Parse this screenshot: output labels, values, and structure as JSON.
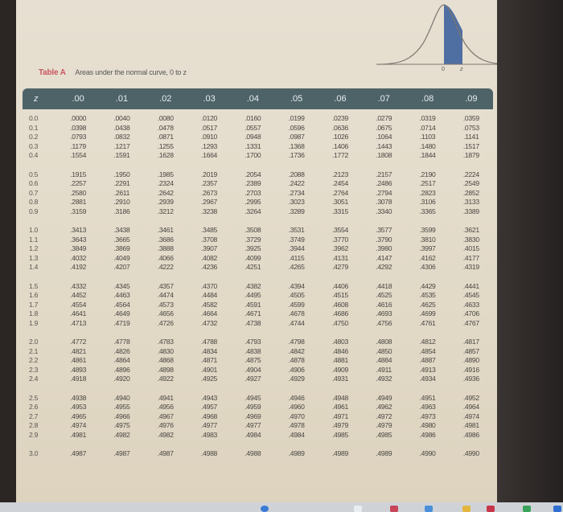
{
  "document": {
    "table_label": "Table A",
    "table_caption": "Areas under the normal curve, 0 to z",
    "figure": {
      "label_zero": "0",
      "label_z": "z",
      "shade_color": "#4f6fa3"
    },
    "columns": [
      "z",
      ".00",
      ".01",
      ".02",
      ".03",
      ".04",
      ".05",
      ".06",
      ".07",
      ".08",
      ".09"
    ],
    "groups": [
      [
        {
          "z": "0.0",
          "v": [
            ".0000",
            ".0040",
            ".0080",
            ".0120",
            ".0160",
            ".0199",
            ".0239",
            ".0279",
            ".0319",
            ".0359"
          ]
        },
        {
          "z": "0.1",
          "v": [
            ".0398",
            ".0438",
            ".0478",
            ".0517",
            ".0557",
            ".0596",
            ".0636",
            ".0675",
            ".0714",
            ".0753"
          ]
        },
        {
          "z": "0.2",
          "v": [
            ".0793",
            ".0832",
            ".0871",
            ".0910",
            ".0948",
            ".0987",
            ".1026",
            ".1064",
            ".1103",
            ".1141"
          ]
        },
        {
          "z": "0.3",
          "v": [
            ".1179",
            ".1217",
            ".1255",
            ".1293",
            ".1331",
            ".1368",
            ".1406",
            ".1443",
            ".1480",
            ".1517"
          ]
        },
        {
          "z": "0.4",
          "v": [
            ".1554",
            ".1591",
            ".1628",
            ".1664",
            ".1700",
            ".1736",
            ".1772",
            ".1808",
            ".1844",
            ".1879"
          ]
        }
      ],
      [
        {
          "z": "0.5",
          "v": [
            ".1915",
            ".1950",
            ".1985",
            ".2019",
            ".2054",
            ".2088",
            ".2123",
            ".2157",
            ".2190",
            ".2224"
          ]
        },
        {
          "z": "0.6",
          "v": [
            ".2257",
            ".2291",
            ".2324",
            ".2357",
            ".2389",
            ".2422",
            ".2454",
            ".2486",
            ".2517",
            ".2549"
          ]
        },
        {
          "z": "0.7",
          "v": [
            ".2580",
            ".2611",
            ".2642",
            ".2673",
            ".2703",
            ".2734",
            ".2764",
            ".2794",
            ".2823",
            ".2852"
          ]
        },
        {
          "z": "0.8",
          "v": [
            ".2881",
            ".2910",
            ".2939",
            ".2967",
            ".2995",
            ".3023",
            ".3051",
            ".3078",
            ".3106",
            ".3133"
          ]
        },
        {
          "z": "0.9",
          "v": [
            ".3159",
            ".3186",
            ".3212",
            ".3238",
            ".3264",
            ".3289",
            ".3315",
            ".3340",
            ".3365",
            ".3389"
          ]
        }
      ],
      [
        {
          "z": "1.0",
          "v": [
            ".3413",
            ".3438",
            ".3461",
            ".3485",
            ".3508",
            ".3531",
            ".3554",
            ".3577",
            ".3599",
            ".3621"
          ]
        },
        {
          "z": "1.1",
          "v": [
            ".3643",
            ".3665",
            ".3686",
            ".3708",
            ".3729",
            ".3749",
            ".3770",
            ".3790",
            ".3810",
            ".3830"
          ]
        },
        {
          "z": "1.2",
          "v": [
            ".3849",
            ".3869",
            ".3888",
            ".3907",
            ".3925",
            ".3944",
            ".3962",
            ".3980",
            ".3997",
            ".4015"
          ]
        },
        {
          "z": "1.3",
          "v": [
            ".4032",
            ".4049",
            ".4066",
            ".4082",
            ".4099",
            ".4115",
            ".4131",
            ".4147",
            ".4162",
            ".4177"
          ]
        },
        {
          "z": "1.4",
          "v": [
            ".4192",
            ".4207",
            ".4222",
            ".4236",
            ".4251",
            ".4265",
            ".4279",
            ".4292",
            ".4306",
            ".4319"
          ]
        }
      ],
      [
        {
          "z": "1.5",
          "v": [
            ".4332",
            ".4345",
            ".4357",
            ".4370",
            ".4382",
            ".4394",
            ".4406",
            ".4418",
            ".4429",
            ".4441"
          ]
        },
        {
          "z": "1.6",
          "v": [
            ".4452",
            ".4463",
            ".4474",
            ".4484",
            ".4495",
            ".4505",
            ".4515",
            ".4525",
            ".4535",
            ".4545"
          ]
        },
        {
          "z": "1.7",
          "v": [
            ".4554",
            ".4564",
            ".4573",
            ".4582",
            ".4591",
            ".4599",
            ".4608",
            ".4616",
            ".4625",
            ".4633"
          ]
        },
        {
          "z": "1.8",
          "v": [
            ".4641",
            ".4649",
            ".4656",
            ".4664",
            ".4671",
            ".4678",
            ".4686",
            ".4693",
            ".4699",
            ".4706"
          ]
        },
        {
          "z": "1.9",
          "v": [
            ".4713",
            ".4719",
            ".4726",
            ".4732",
            ".4738",
            ".4744",
            ".4750",
            ".4756",
            ".4761",
            ".4767"
          ]
        }
      ],
      [
        {
          "z": "2.0",
          "v": [
            ".4772",
            ".4778",
            ".4783",
            ".4788",
            ".4793",
            ".4798",
            ".4803",
            ".4808",
            ".4812",
            ".4817"
          ]
        },
        {
          "z": "2.1",
          "v": [
            ".4821",
            ".4826",
            ".4830",
            ".4834",
            ".4838",
            ".4842",
            ".4846",
            ".4850",
            ".4854",
            ".4857"
          ]
        },
        {
          "z": "2.2",
          "v": [
            ".4861",
            ".4864",
            ".4868",
            ".4871",
            ".4875",
            ".4878",
            ".4881",
            ".4884",
            ".4887",
            ".4890"
          ]
        },
        {
          "z": "2.3",
          "v": [
            ".4893",
            ".4896",
            ".4898",
            ".4901",
            ".4904",
            ".4906",
            ".4909",
            ".4911",
            ".4913",
            ".4916"
          ]
        },
        {
          "z": "2.4",
          "v": [
            ".4918",
            ".4920",
            ".4922",
            ".4925",
            ".4927",
            ".4929",
            ".4931",
            ".4932",
            ".4934",
            ".4936"
          ]
        }
      ],
      [
        {
          "z": "2.5",
          "v": [
            ".4938",
            ".4940",
            ".4941",
            ".4943",
            ".4945",
            ".4946",
            ".4948",
            ".4949",
            ".4951",
            ".4952"
          ]
        },
        {
          "z": "2.6",
          "v": [
            ".4953",
            ".4955",
            ".4956",
            ".4957",
            ".4959",
            ".4960",
            ".4961",
            ".4962",
            ".4963",
            ".4964"
          ]
        },
        {
          "z": "2.7",
          "v": [
            ".4965",
            ".4966",
            ".4967",
            ".4968",
            ".4969",
            ".4970",
            ".4971",
            ".4972",
            ".4973",
            ".4974"
          ]
        },
        {
          "z": "2.8",
          "v": [
            ".4974",
            ".4975",
            ".4976",
            ".4977",
            ".4977",
            ".4978",
            ".4979",
            ".4979",
            ".4980",
            ".4981"
          ]
        },
        {
          "z": "2.9",
          "v": [
            ".4981",
            ".4982",
            ".4982",
            ".4983",
            ".4984",
            ".4984",
            ".4985",
            ".4985",
            ".4986",
            ".4986"
          ]
        }
      ],
      [
        {
          "z": "3.0",
          "v": [
            ".4987",
            ".4987",
            ".4987",
            ".4988",
            ".4988",
            ".4989",
            ".4989",
            ".4989",
            ".4990",
            ".4990"
          ]
        }
      ]
    ]
  }
}
